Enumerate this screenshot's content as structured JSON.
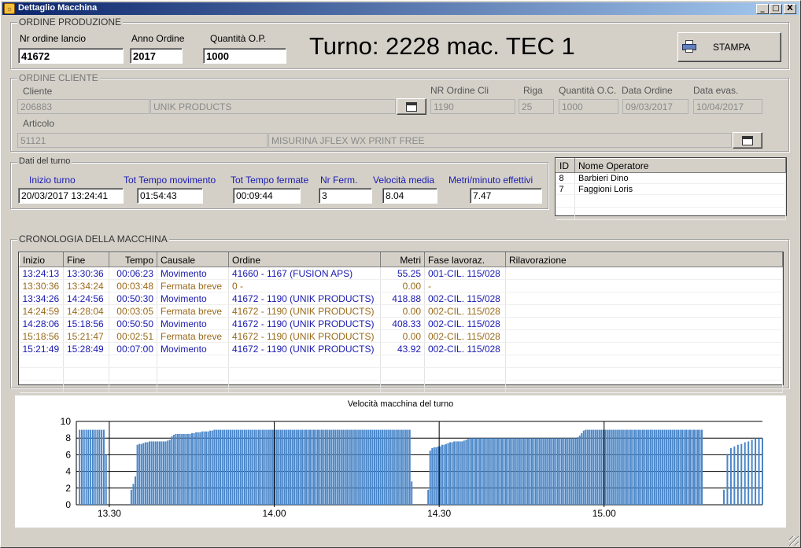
{
  "window": {
    "title": "Dettaglio Macchina",
    "controls": [
      "_",
      "□",
      "X"
    ]
  },
  "produzione": {
    "group_title": "ORDINE PRODUZIONE",
    "nr_ordine_label": "Nr ordine lancio",
    "nr_ordine_value": "41672",
    "anno_label": "Anno Ordine",
    "anno_value": "2017",
    "quantita_label": "Quantità O.P.",
    "quantita_value": "1000",
    "turno_text": "Turno: 2228 mac. TEC 1",
    "stampa_label": "STAMPA"
  },
  "cliente": {
    "group_title": "ORDINE CLIENTE",
    "cliente_label": "Cliente",
    "cliente_code": "206883",
    "cliente_name": "UNIK PRODUCTS",
    "nr_ordine_cli_label": "NR Ordine Cli",
    "nr_ordine_cli_value": "1190",
    "riga_label": "Riga",
    "riga_value": "25",
    "quantita_oc_label": "Quantità O.C.",
    "quantita_oc_value": "1000",
    "data_ordine_label": "Data Ordine",
    "data_ordine_value": "09/03/2017",
    "data_evas_label": "Data evas.",
    "data_evas_value": "10/04/2017",
    "articolo_label": "Articolo",
    "articolo_code": "51121",
    "articolo_desc": "MISURINA JFLEX WX PRINT FREE"
  },
  "turno_dati": {
    "group_title": "Dati del turno",
    "inizio_label": "Inizio turno",
    "inizio_value": "20/03/2017 13:24:41",
    "tempo_mov_label": "Tot Tempo movimento",
    "tempo_mov_value": "01:54:43",
    "tempo_ferm_label": "Tot Tempo fermate",
    "tempo_ferm_value": "00:09:44",
    "nr_ferm_label": "Nr Ferm.",
    "nr_ferm_value": "3",
    "velocita_label": "Velocità media",
    "velocita_value": "8.04",
    "metri_label": "Metri/minuto effettivi",
    "metri_value": "7.47"
  },
  "operatori": {
    "headers": [
      "ID",
      "Nome Operatore"
    ],
    "rows": [
      {
        "id": "8",
        "nome": "Barbieri Dino"
      },
      {
        "id": "7",
        "nome": "Faggioni Loris"
      }
    ]
  },
  "cronologia": {
    "group_title": "CRONOLOGIA DELLA MACCHINA",
    "headers": [
      "Inizio",
      "Fine",
      "Tempo",
      "Causale",
      "Ordine",
      "Metri",
      "Fase lavoraz.",
      "Rilavorazione"
    ],
    "rows": [
      {
        "inizio": "13:24:13",
        "fine": "13:30:36",
        "tempo": "00:06:23",
        "causale": "Movimento",
        "ordine": "41660 - 1167 (FUSION APS)",
        "metri": "55.25",
        "fase": "001-CIL. 115/028",
        "ril": "",
        "kind": "mov"
      },
      {
        "inizio": "13:30:36",
        "fine": "13:34:24",
        "tempo": "00:03:48",
        "causale": "Fermata breve",
        "ordine": "0 -",
        "metri": "0.00",
        "fase": "-",
        "ril": "",
        "kind": "ferm"
      },
      {
        "inizio": "13:34:26",
        "fine": "14:24:56",
        "tempo": "00:50:30",
        "causale": "Movimento",
        "ordine": "41672 - 1190 (UNIK PRODUCTS)",
        "metri": "418.88",
        "fase": "002-CIL. 115/028",
        "ril": "",
        "kind": "mov"
      },
      {
        "inizio": "14:24:59",
        "fine": "14:28:04",
        "tempo": "00:03:05",
        "causale": "Fermata breve",
        "ordine": "41672 - 1190 (UNIK PRODUCTS)",
        "metri": "0.00",
        "fase": "002-CIL. 115/028",
        "ril": "",
        "kind": "ferm"
      },
      {
        "inizio": "14:28:06",
        "fine": "15:18:56",
        "tempo": "00:50:50",
        "causale": "Movimento",
        "ordine": "41672 - 1190 (UNIK PRODUCTS)",
        "metri": "408.33",
        "fase": "002-CIL. 115/028",
        "ril": "",
        "kind": "mov"
      },
      {
        "inizio": "15:18:56",
        "fine": "15:21:47",
        "tempo": "00:02:51",
        "causale": "Fermata breve",
        "ordine": "41672 - 1190 (UNIK PRODUCTS)",
        "metri": "0.00",
        "fase": "002-CIL. 115/028",
        "ril": "",
        "kind": "ferm"
      },
      {
        "inizio": "15:21:49",
        "fine": "15:28:49",
        "tempo": "00:07:00",
        "causale": "Movimento",
        "ordine": "41672 - 1190 (UNIK PRODUCTS)",
        "metri": "43.92",
        "fase": "002-CIL. 115/028",
        "ril": "",
        "kind": "mov"
      }
    ],
    "empty_rows": 3
  },
  "colors": {
    "movimento": "#1a1ab0",
    "fermata": "#9a6a1a",
    "bar": "#4a86c8",
    "window_bg": "#d4d0c8"
  },
  "chart_data": {
    "type": "bar",
    "title": "Velocità macchina del turno",
    "xlabel": "",
    "ylabel": "",
    "ylim": [
      0,
      10
    ],
    "yticks": [
      0,
      2,
      4,
      6,
      8,
      10
    ],
    "xtick_labels": [
      "13.30",
      "14.00",
      "14.30",
      "15.00"
    ],
    "xtick_times": [
      13.5,
      14.0,
      14.5,
      15.0
    ],
    "xlim": [
      13.4,
      15.48
    ],
    "segments": [
      {
        "start": 13.41,
        "end": 13.49,
        "values": [
          9,
          9,
          9,
          9,
          9,
          9,
          9,
          9,
          9,
          9,
          9,
          9,
          6
        ]
      },
      {
        "start": 13.5667,
        "end": 13.99,
        "values": [
          1.8,
          2.5,
          3.4,
          7.2,
          7.3,
          7.3,
          7.4,
          7.5,
          7.5,
          7.6,
          7.6,
          7.6,
          7.6,
          7.6,
          7.6,
          7.6,
          7.6,
          7.6,
          7.7,
          7.8,
          8.2,
          8.4,
          8.5,
          8.5,
          8.5,
          8.5,
          8.5,
          8.5,
          8.5,
          8.5,
          8.6,
          8.6,
          8.7,
          8.7,
          8.7,
          8.8,
          8.8,
          8.8,
          8.8,
          8.9,
          8.9,
          9,
          9,
          9,
          9,
          9,
          9,
          9,
          9,
          9,
          9,
          9,
          9,
          9,
          9,
          9,
          9,
          9,
          9,
          9,
          9,
          9,
          9,
          9,
          9,
          9,
          9,
          9,
          9,
          9
        ]
      },
      {
        "start": 13.99,
        "end": 14.4167,
        "values": [
          9,
          9,
          9,
          9,
          9,
          9,
          9,
          9,
          9,
          9,
          9,
          9,
          9,
          9,
          9,
          9,
          9,
          9,
          9,
          9,
          9,
          9,
          9,
          9,
          9,
          9,
          9,
          9,
          9,
          9,
          9,
          9,
          9,
          9,
          9,
          9,
          9,
          9,
          9,
          9,
          9,
          9,
          9,
          9,
          9,
          9,
          9,
          9,
          9,
          9,
          9,
          9,
          9,
          9,
          9,
          9,
          9,
          9,
          9,
          9,
          9,
          9,
          9,
          9,
          9,
          9,
          9,
          9,
          9,
          9,
          9,
          9,
          2.8
        ]
      },
      {
        "start": 14.4667,
        "end": 14.92,
        "values": [
          1.8,
          6.5,
          6.8,
          6.9,
          6.9,
          7,
          7,
          7.2,
          7.2,
          7.3,
          7.4,
          7.5,
          7.5,
          7.6,
          7.6,
          7.6,
          7.6,
          7.6,
          7.7,
          7.8,
          7.9,
          8,
          8,
          8,
          8,
          8,
          8,
          8,
          8,
          8,
          8,
          8,
          8,
          8,
          8,
          8,
          8,
          8,
          8,
          8,
          8,
          8,
          8,
          8,
          8,
          8,
          8,
          8,
          8,
          8,
          8,
          8,
          8,
          8,
          8,
          8,
          8,
          8,
          8,
          8,
          8,
          8,
          8,
          8,
          8,
          8,
          8,
          8,
          8,
          8,
          8,
          8,
          8,
          8,
          8,
          8
        ]
      },
      {
        "start": 14.92,
        "end": 15.2964,
        "values": [
          8.1,
          8.3,
          8.6,
          8.9,
          9,
          9,
          9,
          9,
          9,
          9,
          9,
          9,
          9,
          9,
          9,
          9,
          9,
          9,
          9,
          9,
          9,
          9,
          9,
          9,
          9,
          9,
          9,
          9,
          9,
          9,
          9,
          9,
          9,
          9,
          9,
          9,
          9,
          9,
          9,
          9,
          9,
          9,
          9,
          9,
          9,
          9,
          9,
          9,
          9,
          9,
          9,
          9,
          9,
          9,
          9,
          9,
          9,
          9,
          9,
          9,
          9,
          9,
          9,
          9
        ]
      },
      {
        "start": 15.3631,
        "end": 15.48,
        "values": [
          1.8,
          6.1,
          6.8,
          7,
          7.2,
          7.3,
          7.5,
          7.6,
          7.8,
          8,
          8,
          8
        ]
      }
    ]
  }
}
